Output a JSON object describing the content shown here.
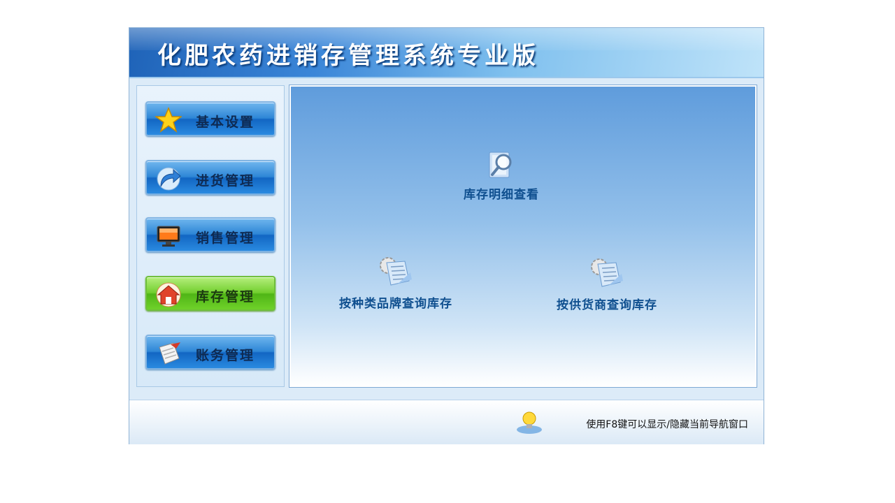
{
  "app": {
    "title": "化肥农药进销存管理系统专业版"
  },
  "sidebar": {
    "items": [
      {
        "label": "基本设置",
        "icon": "star-icon",
        "active": false
      },
      {
        "label": "进货管理",
        "icon": "arrow-icon",
        "active": false
      },
      {
        "label": "销售管理",
        "icon": "monitor-icon",
        "active": false
      },
      {
        "label": "库存管理",
        "icon": "house-icon",
        "active": true
      },
      {
        "label": "账务管理",
        "icon": "scroll-icon",
        "active": false
      }
    ]
  },
  "main": {
    "functions": [
      {
        "label": "库存明细查看",
        "icon": "magnifier-icon"
      },
      {
        "label": "按种类品牌查询库存",
        "icon": "document-gear-icon"
      },
      {
        "label": "按供货商查询库存",
        "icon": "document-gear-icon"
      }
    ]
  },
  "status": {
    "hint": "使用F8键可以显示/隐藏当前导航窗口",
    "icon": "lightbulb-icon"
  },
  "colors": {
    "accent": "#1f63b8",
    "active": "#72cf2e",
    "label": "#0f4f8f"
  }
}
